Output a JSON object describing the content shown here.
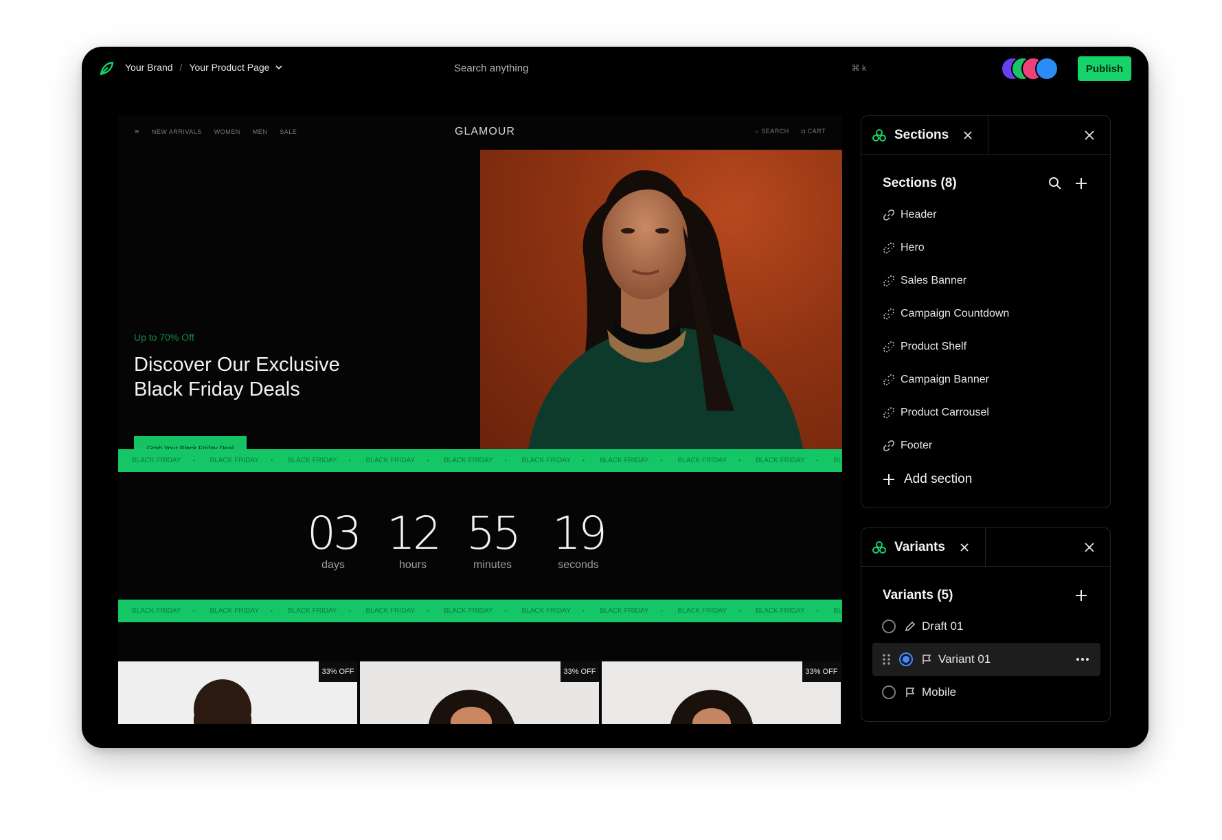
{
  "topbar": {
    "brand": "Your Brand",
    "separator": "/",
    "page": "Your Product Page",
    "search_placeholder": "Search anything",
    "search_shortcut": "⌘ k",
    "publish_label": "Publish",
    "avatar_colors": [
      "#6a3ff0",
      "#1bc26b",
      "#f0407a",
      "#2c8cf6"
    ]
  },
  "site": {
    "nav_left": [
      "NEW ARRIVALS",
      "WOMEN",
      "MEN",
      "SALE"
    ],
    "brand": "GLAMOUR",
    "nav_right": [
      "SEARCH",
      "CART"
    ],
    "hero_tag": "Up to 70% Off",
    "hero_title_line1": "Discover Our Exclusive",
    "hero_title_line2": "Black Friday Deals",
    "hero_cta": "Grab Your Black Friday Deal",
    "ticker_text": "BLACK FRIDAY",
    "countdown": [
      {
        "value": "03",
        "label": "days"
      },
      {
        "value": "12",
        "label": "hours"
      },
      {
        "value": "55",
        "label": "minutes"
      },
      {
        "value": "19",
        "label": "seconds"
      }
    ],
    "product_badge": "33% OFF"
  },
  "sections_panel": {
    "tab_label": "Sections",
    "title": "Sections (8)",
    "items": [
      "Header",
      "Hero",
      "Sales Banner",
      "Campaign Countdown",
      "Product Shelf",
      "Campaign Banner",
      "Product Carrousel",
      "Footer"
    ],
    "add_label": "Add section"
  },
  "variants_panel": {
    "tab_label": "Variants",
    "title": "Variants (5)",
    "items": [
      {
        "label": "Draft 01",
        "icon": "pencil-icon",
        "selected": false
      },
      {
        "label": "Variant 01",
        "icon": "flag-icon",
        "selected": true
      },
      {
        "label": "Mobile",
        "icon": "flag-icon",
        "selected": false
      }
    ]
  },
  "colors": {
    "accent": "#15d36a",
    "background": "#000000",
    "panel_border": "#262626"
  }
}
